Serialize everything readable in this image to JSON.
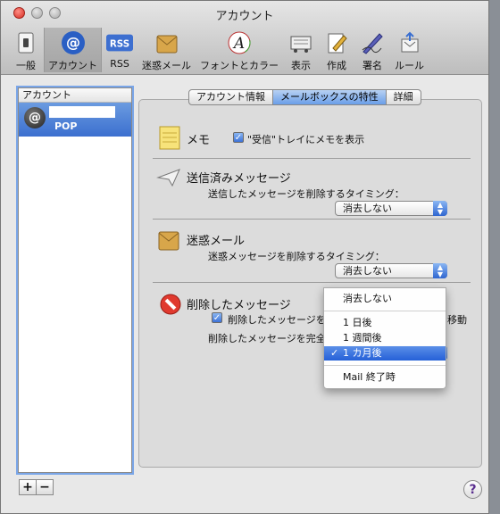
{
  "window": {
    "title": "アカウント"
  },
  "toolbar": {
    "items": [
      {
        "label": "一般",
        "icon": "switch-icon"
      },
      {
        "label": "アカウント",
        "icon": "at-sign-icon",
        "selected": true
      },
      {
        "label": "RSS",
        "icon": "rss-icon"
      },
      {
        "label": "迷惑メール",
        "icon": "junk-mail-icon"
      },
      {
        "label": "フォントとカラー",
        "icon": "font-color-icon"
      },
      {
        "label": "表示",
        "icon": "display-icon"
      },
      {
        "label": "作成",
        "icon": "compose-icon"
      },
      {
        "label": "署名",
        "icon": "signature-icon"
      },
      {
        "label": "ルール",
        "icon": "rules-icon"
      }
    ]
  },
  "sidebar": {
    "header": "アカウント",
    "accounts": [
      {
        "type": "POP",
        "icon": "at-sign-icon"
      }
    ],
    "add_label": "+",
    "remove_label": "−"
  },
  "tabs": [
    {
      "label": "アカウント情報"
    },
    {
      "label": "メールボックスの特性",
      "active": true
    },
    {
      "label": "詳細"
    }
  ],
  "sections": {
    "notes": {
      "title": "メモ",
      "checkbox_label": "\"受信\"トレイにメモを表示",
      "checked": true
    },
    "sent": {
      "title": "送信済みメッセージ",
      "desc": "送信したメッセージを削除するタイミング：",
      "popup_value": "消去しない"
    },
    "junk": {
      "title": "迷惑メール",
      "desc": "迷惑メッセージを削除するタイミング：",
      "popup_value": "消去しない"
    },
    "trash": {
      "title": "削除したメッセージ",
      "checkbox_label": "削除したメッセージを",
      "checkbox_label_tail": "移動",
      "checked": true,
      "desc": "削除したメッセージを完全"
    }
  },
  "dropdown_menu": {
    "options": [
      "消去しない",
      "1 日後",
      "1 週間後",
      "1 カ月後",
      "Mail 終了時"
    ],
    "selected": "1 カ月後",
    "check_mark": "✓"
  },
  "help": {
    "label": "?"
  },
  "colors": {
    "accent": "#3b6fcf",
    "selection": "#2560d8"
  }
}
